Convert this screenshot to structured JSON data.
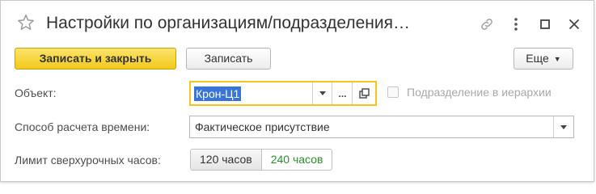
{
  "window": {
    "title": "Настройки по организациям/подразделения…"
  },
  "toolbar": {
    "save_close_label": "Записать и закрыть",
    "save_label": "Записать",
    "more_label": "Еще"
  },
  "form": {
    "object": {
      "label": "Объект:",
      "value": "Крон-Ц1",
      "dots": "..."
    },
    "hierarchy": {
      "label": "Подразделение в иерархии",
      "checked": false
    },
    "time_method": {
      "label": "Способ расчета времени:",
      "value": "Фактическое присутствие"
    },
    "overtime_limit": {
      "label": "Лимит сверхурочных часов:",
      "options": [
        "120 часов",
        "240 часов"
      ],
      "selected": "240 часов"
    }
  },
  "colors": {
    "primary_button": "#f2c81b",
    "focus_border": "#f2c81b",
    "selection": "#3875d7",
    "selected_option_text": "#2a8f2a"
  }
}
